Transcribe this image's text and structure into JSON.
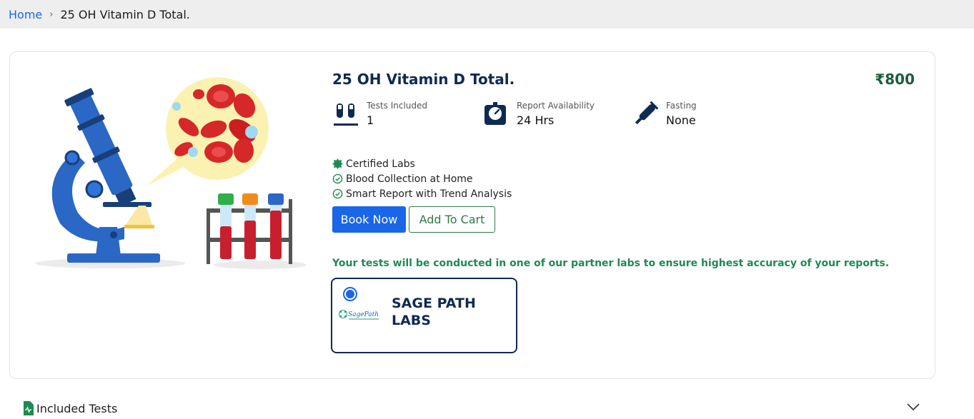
{
  "breadcrumb": {
    "home": "Home",
    "separator": "›",
    "current": "25 OH Vitamin D Total."
  },
  "product": {
    "title": "25 OH Vitamin D Total.",
    "price": "₹800",
    "meta": [
      {
        "icon": "test-tubes-icon",
        "label": "Tests Included",
        "value": "1"
      },
      {
        "icon": "stopwatch-icon",
        "label": "Report Availability",
        "value": "24 Hrs"
      },
      {
        "icon": "syringe-icon",
        "label": "Fasting",
        "value": "None"
      }
    ],
    "features": [
      "Certified Labs",
      "Blood Collection at Home",
      "Smart Report with Trend Analysis"
    ],
    "book_label": "Book Now",
    "cart_label": "Add To Cart",
    "partner_note": "Your tests will be conducted in one of our partner labs to ensure highest accuracy of your reports.",
    "lab": {
      "name": "SAGE PATH LABS",
      "logo_text": "SagePath",
      "selected": true
    }
  },
  "included_tests": {
    "label": "Included Tests"
  },
  "colors": {
    "primary": "#1a66e8",
    "navy": "#0f2a52",
    "green": "#1f8a52",
    "price_green": "#1b5e3a"
  }
}
